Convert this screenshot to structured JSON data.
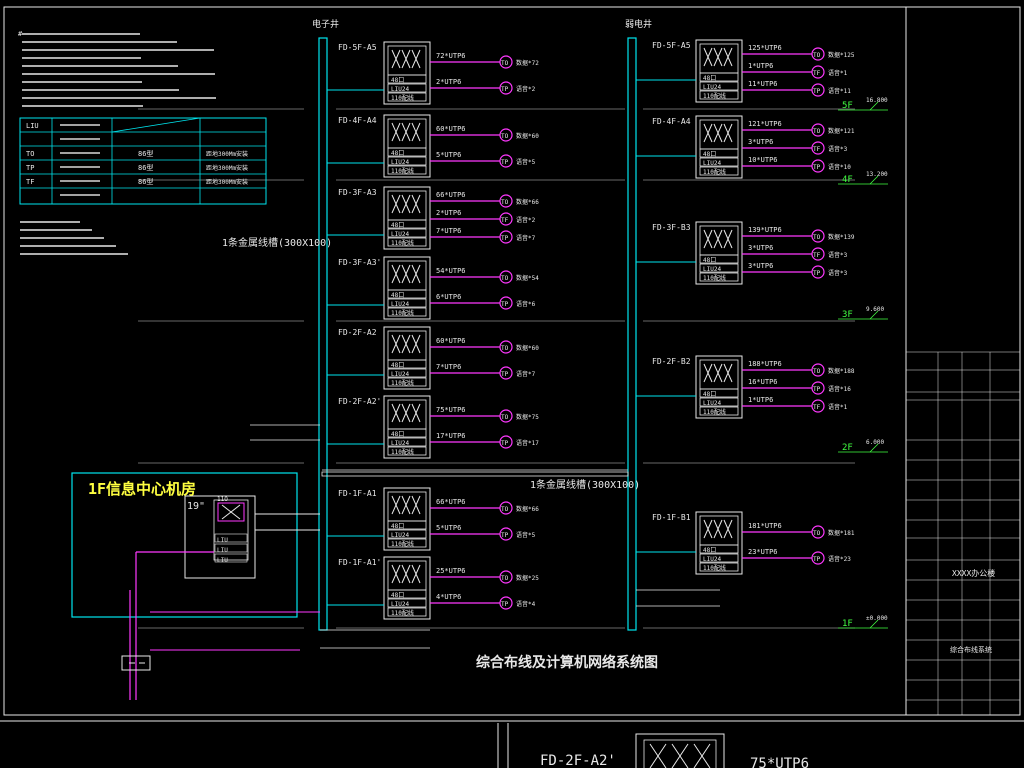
{
  "title": "综合布线及计算机网络系统图",
  "header": {
    "left_duct": "电子井",
    "right_duct": "弱电井"
  },
  "room": {
    "title": "1F信息中心机房",
    "rack": "19\"",
    "labels": [
      "11O",
      "LIU",
      "LIU",
      "LIU"
    ]
  },
  "duct_labels": {
    "upper": "1条金属线槽(300X100)",
    "lower": "1条金属线槽(300X100)"
  },
  "legend_rows": [
    {
      "sym": "LIU",
      "a": "",
      "b": "",
      "c": ""
    },
    {
      "sym": "",
      "a": "",
      "b": "",
      "c": ""
    },
    {
      "sym": "TO",
      "a": "",
      "b": "86型",
      "c": "距地300Mm安装"
    },
    {
      "sym": "TP",
      "a": "",
      "b": "86型",
      "c": "距地300Mm安装"
    },
    {
      "sym": "TF",
      "a": "",
      "b": "86型",
      "c": "距地300Mm安装"
    },
    {
      "sym": "",
      "a": "",
      "b": "",
      "c": ""
    }
  ],
  "floors": [
    {
      "label": "5F",
      "elev": "16.800"
    },
    {
      "label": "4F",
      "elev": "13.200"
    },
    {
      "label": "3F",
      "elev": "9.600"
    },
    {
      "label": "2F",
      "elev": "6.000"
    },
    {
      "label": "1F",
      "elev": "±0.000"
    }
  ],
  "left_fds": [
    {
      "name": "FD-5F-A5",
      "rows": [
        {
          "cable": "72*UTP6",
          "tag": "TO",
          "count": "数据*72"
        },
        {
          "cable": "2*UTP6",
          "tag": "TP",
          "count": "语音*2"
        }
      ]
    },
    {
      "name": "FD-4F-A4",
      "rows": [
        {
          "cable": "60*UTP6",
          "tag": "TO",
          "count": "数据*60"
        },
        {
          "cable": "5*UTP6",
          "tag": "TP",
          "count": "语音*5"
        }
      ]
    },
    {
      "name": "FD-3F-A3",
      "rows": [
        {
          "cable": "66*UTP6",
          "tag": "TO",
          "count": "数据*66"
        },
        {
          "cable": "2*UTP6",
          "tag": "TF",
          "count": "语音*2"
        },
        {
          "cable": "7*UTP6",
          "tag": "TP",
          "count": "语音*7"
        }
      ]
    },
    {
      "name": "FD-3F-A3'",
      "rows": [
        {
          "cable": "54*UTP6",
          "tag": "TO",
          "count": "数据*54"
        },
        {
          "cable": "6*UTP6",
          "tag": "TP",
          "count": "语音*6"
        }
      ]
    },
    {
      "name": "FD-2F-A2",
      "rows": [
        {
          "cable": "60*UTP6",
          "tag": "TO",
          "count": "数据*60"
        },
        {
          "cable": "7*UTP6",
          "tag": "TP",
          "count": "语音*7"
        }
      ]
    },
    {
      "name": "FD-2F-A2'",
      "rows": [
        {
          "cable": "75*UTP6",
          "tag": "TO",
          "count": "数据*75"
        },
        {
          "cable": "17*UTP6",
          "tag": "TP",
          "count": "语音*17"
        }
      ]
    },
    {
      "name": "FD-1F-A1",
      "rows": [
        {
          "cable": "66*UTP6",
          "tag": "TO",
          "count": "数据*66"
        },
        {
          "cable": "5*UTP6",
          "tag": "TP",
          "count": "语音*5"
        }
      ]
    },
    {
      "name": "FD-1F-A1'",
      "rows": [
        {
          "cable": "25*UTP6",
          "tag": "TO",
          "count": "数据*25"
        },
        {
          "cable": "4*UTP6",
          "tag": "TP",
          "count": "语音*4"
        }
      ]
    }
  ],
  "right_fds": [
    {
      "name": "FD-5F-A5",
      "rows": [
        {
          "cable": "125*UTP6",
          "tag": "TO",
          "count": "数据*125"
        },
        {
          "cable": "1*UTP6",
          "tag": "TF",
          "count": "语音*1"
        },
        {
          "cable": "11*UTP6",
          "tag": "TP",
          "count": "语音*11"
        }
      ]
    },
    {
      "name": "FD-4F-A4",
      "rows": [
        {
          "cable": "121*UTP6",
          "tag": "TO",
          "count": "数据*121"
        },
        {
          "cable": "3*UTP6",
          "tag": "TF",
          "count": "语音*3"
        },
        {
          "cable": "10*UTP6",
          "tag": "TP",
          "count": "语音*10"
        }
      ]
    },
    {
      "name": "FD-3F-B3",
      "rows": [
        {
          "cable": "139*UTP6",
          "tag": "TO",
          "count": "数据*139"
        },
        {
          "cable": "3*UTP6",
          "tag": "TF",
          "count": "语音*3"
        },
        {
          "cable": "3*UTP6",
          "tag": "TP",
          "count": "语音*3"
        }
      ]
    },
    {
      "name": "FD-2F-B2",
      "rows": [
        {
          "cable": "188*UTP6",
          "tag": "TO",
          "count": "数据*188"
        },
        {
          "cable": "16*UTP6",
          "tag": "TP",
          "count": "语音*16"
        },
        {
          "cable": "1*UTP6",
          "tag": "TF",
          "count": "语音*1"
        }
      ]
    },
    {
      "name": "FD-1F-B1",
      "rows": [
        {
          "cable": "181*UTP6",
          "tag": "TO",
          "count": "数据*181"
        },
        {
          "cable": "23*UTP6",
          "tag": "TP",
          "count": "语音*23"
        }
      ]
    }
  ],
  "block_labels": {
    "top": "48口",
    "mid": "LIU24",
    "bottom": "110配线"
  },
  "title_block": {
    "project": "XXXX办公楼",
    "drawing": "综合布线系统"
  },
  "bottom_strip": {
    "fd": "FD-2F-A2'",
    "cable": "75*UTP6"
  },
  "colors": {
    "bg": "#000000",
    "line": "#00e5ee",
    "outlet": "#ff38ff",
    "text": "#e8e8e8",
    "title": "#ffff40"
  }
}
